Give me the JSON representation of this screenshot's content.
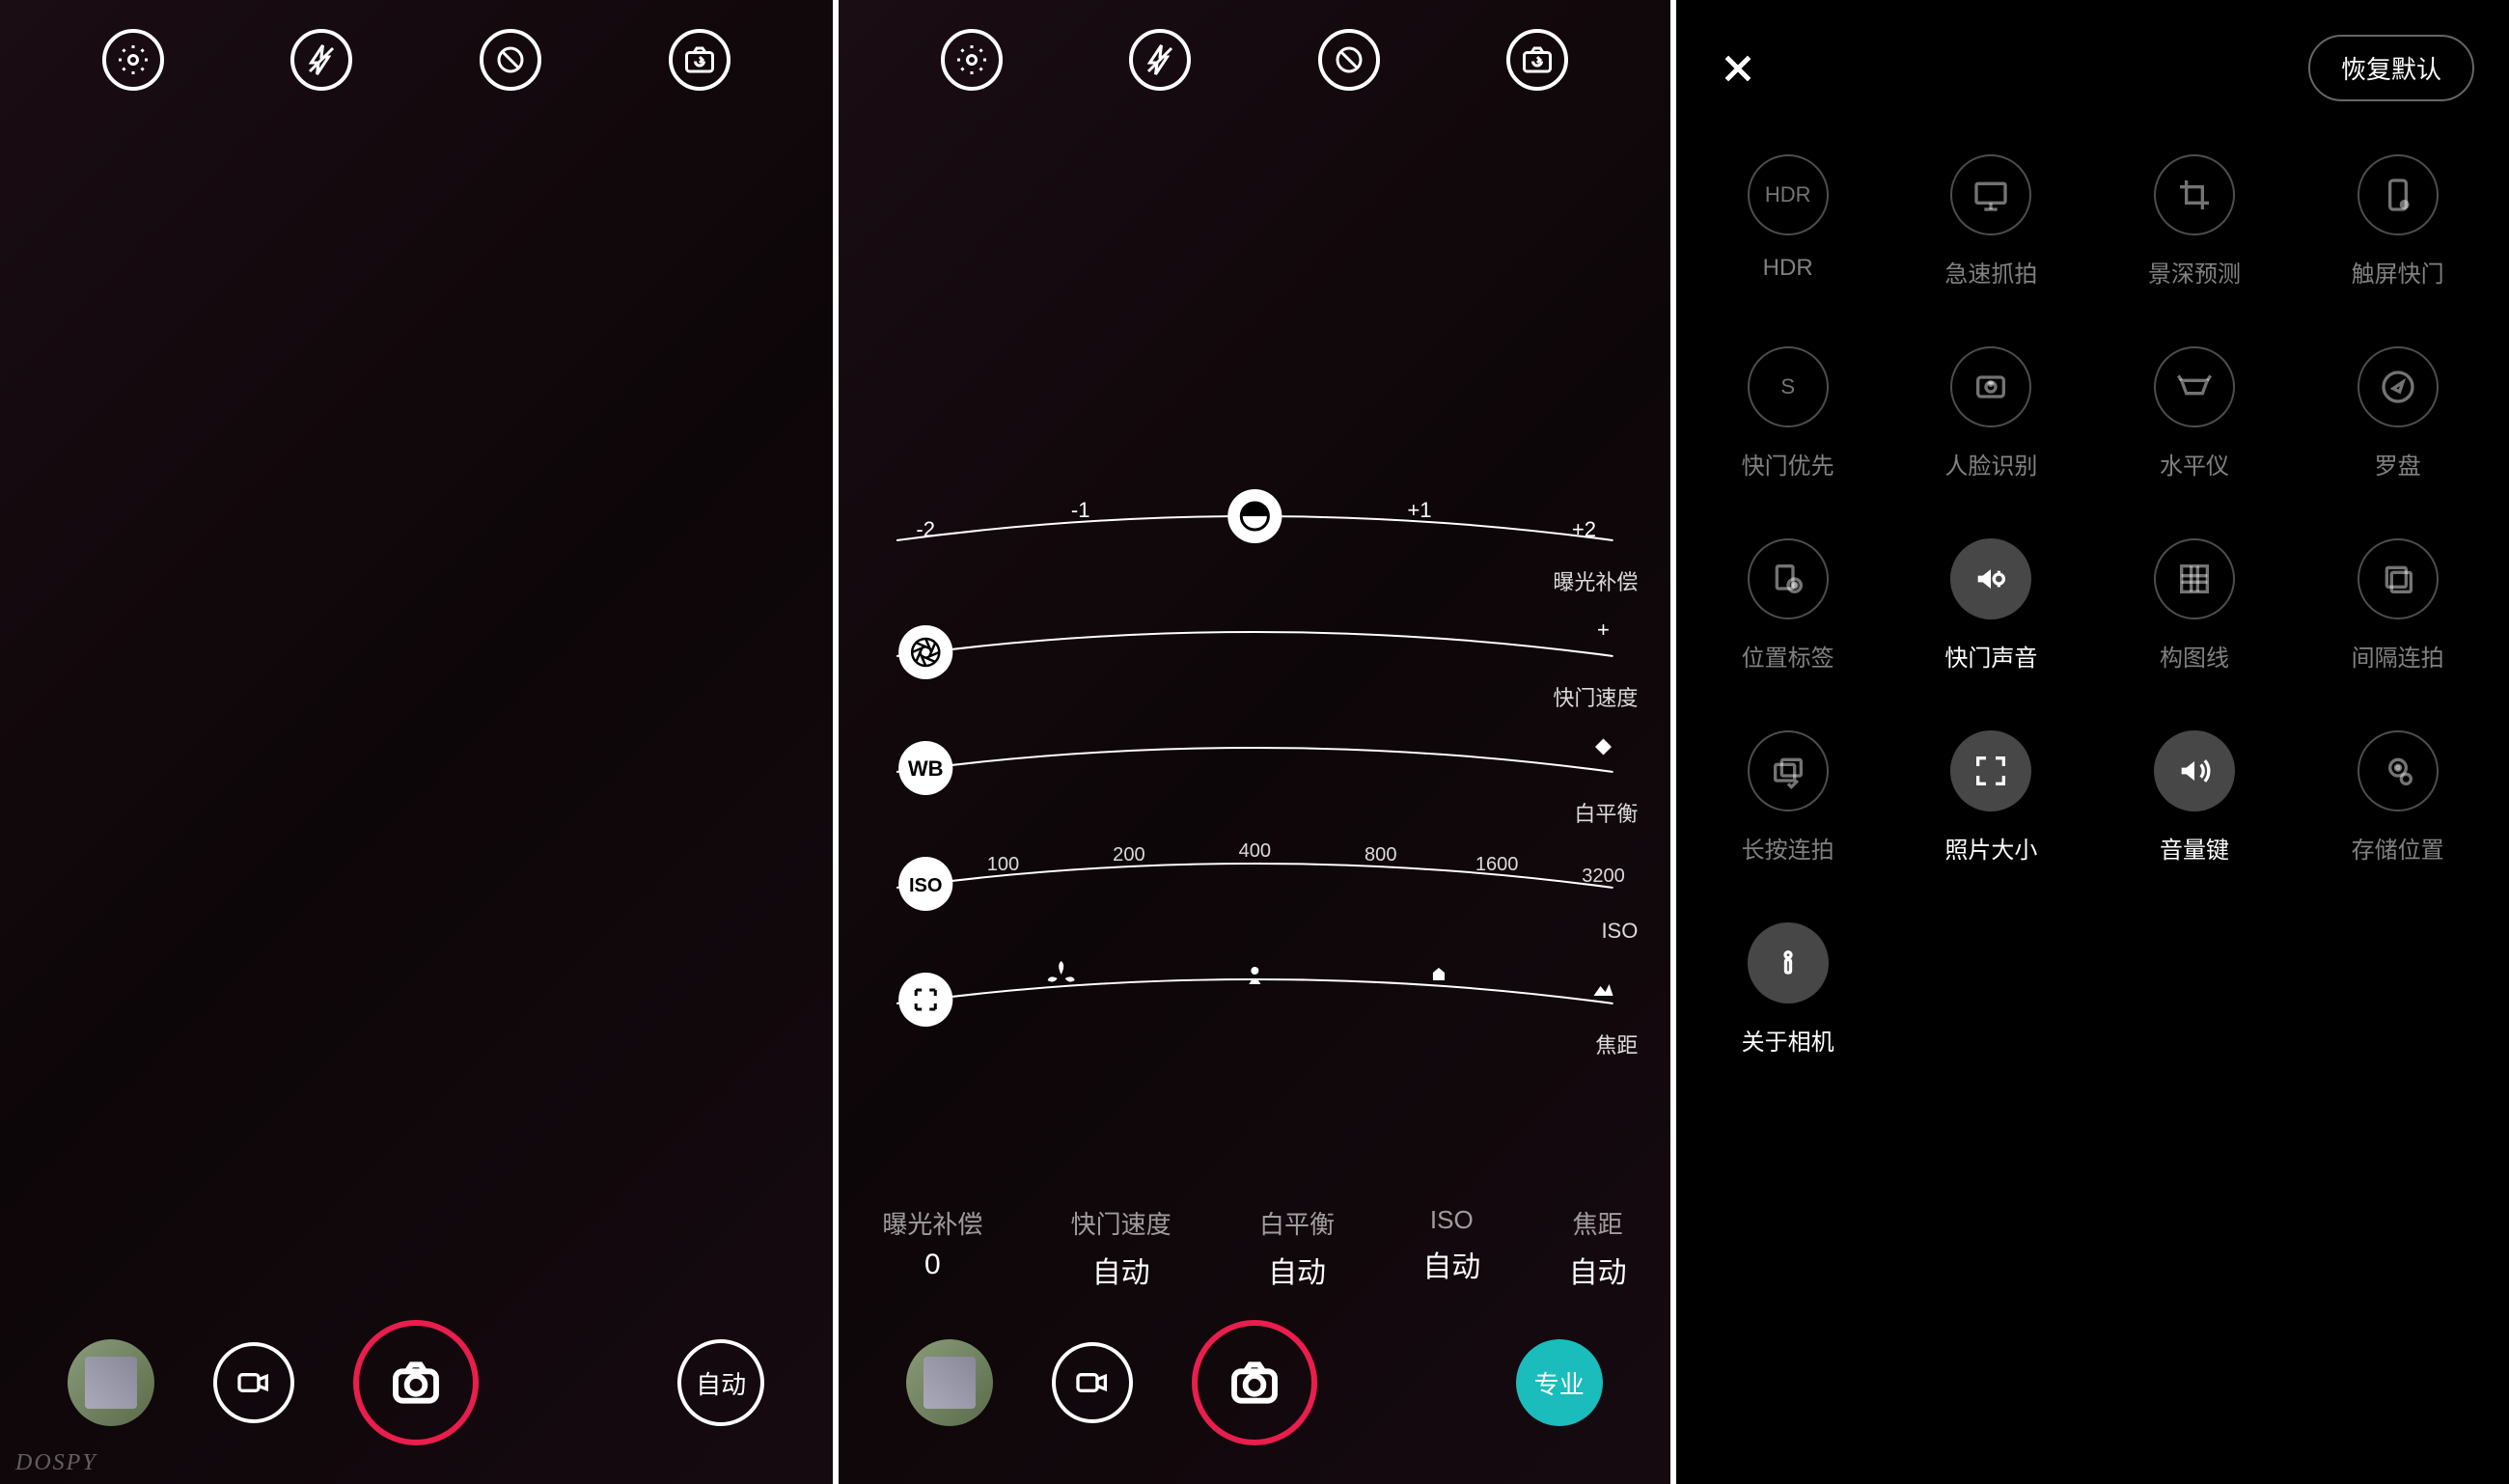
{
  "watermark": "DOSPY",
  "panel1": {
    "mode_button": "自动"
  },
  "panel2": {
    "mode_button": "专业",
    "sliders": {
      "exposure": {
        "label": "曝光补偿",
        "ticks": [
          "-2",
          "-1",
          "",
          "+1",
          "+2"
        ]
      },
      "shutter": {
        "label": "快门速度",
        "plus": "+"
      },
      "wb": {
        "label": "白平衡"
      },
      "iso": {
        "label": "ISO",
        "ticks": [
          "100",
          "200",
          "400",
          "800",
          "1600",
          "3200"
        ]
      },
      "focus": {
        "label": "焦距"
      }
    },
    "readouts": [
      {
        "label": "曝光补偿",
        "value": "0"
      },
      {
        "label": "快门速度",
        "value": "自动"
      },
      {
        "label": "白平衡",
        "value": "自动"
      },
      {
        "label": "ISO",
        "value": "自动"
      },
      {
        "label": "焦距",
        "value": "自动"
      }
    ]
  },
  "panel3": {
    "reset": "恢复默认",
    "items": [
      {
        "id": "hdr",
        "label": "HDR",
        "icon": "hdr",
        "active": false
      },
      {
        "id": "burst-fast",
        "label": "急速抓拍",
        "icon": "monitor",
        "active": false
      },
      {
        "id": "depth",
        "label": "景深预测",
        "icon": "crop",
        "active": false
      },
      {
        "id": "touch-shutter",
        "label": "触屏快门",
        "icon": "touch",
        "active": false
      },
      {
        "id": "shutter-priority",
        "label": "快门优先",
        "icon": "s-circle",
        "active": false
      },
      {
        "id": "face-detect",
        "label": "人脸识别",
        "icon": "face",
        "active": false
      },
      {
        "id": "level",
        "label": "水平仪",
        "icon": "level",
        "active": false
      },
      {
        "id": "compass",
        "label": "罗盘",
        "icon": "compass",
        "active": false
      },
      {
        "id": "geotag",
        "label": "位置标签",
        "icon": "geotag",
        "active": false
      },
      {
        "id": "shutter-sound",
        "label": "快门声音",
        "icon": "sound-gear",
        "active": true
      },
      {
        "id": "grid-lines",
        "label": "构图线",
        "icon": "grid",
        "active": false
      },
      {
        "id": "interval",
        "label": "间隔连拍",
        "icon": "stack",
        "active": false
      },
      {
        "id": "hold-burst",
        "label": "长按连拍",
        "icon": "burst",
        "active": false
      },
      {
        "id": "photo-size",
        "label": "照片大小",
        "icon": "fullscreen",
        "active": true
      },
      {
        "id": "volume-key",
        "label": "音量键",
        "icon": "volume",
        "active": true
      },
      {
        "id": "storage",
        "label": "存储位置",
        "icon": "storage",
        "active": false
      },
      {
        "id": "about",
        "label": "关于相机",
        "icon": "info",
        "active": true
      }
    ]
  }
}
